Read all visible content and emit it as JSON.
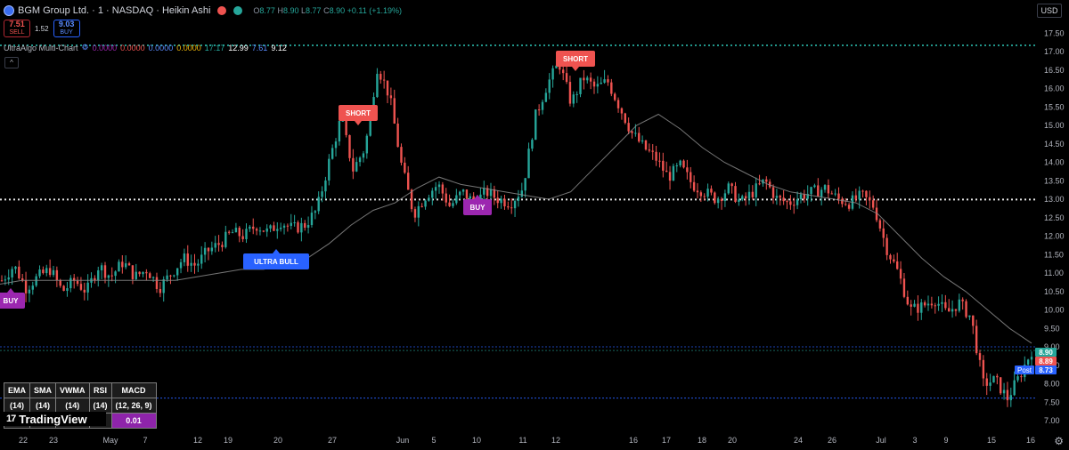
{
  "header": {
    "title": "BGM Group Ltd. · 1 · NASDAQ · Heikin Ashi",
    "ohlc": {
      "o_label": "O",
      "o": "8.77",
      "h_label": "H",
      "h": "8.90",
      "l_label": "L",
      "l": "8.77",
      "c_label": "C",
      "c": "8.90",
      "chg": "+0.11 (+1.19%)"
    },
    "sell_price": "7.51",
    "sell_label": "SELL",
    "spread": "1.52",
    "buy_price": "9.03",
    "buy_label": "BUY",
    "currency": "USD"
  },
  "indicator": {
    "name": "UltraAlgo Multi-Chart",
    "values": [
      "0.0000",
      "0.0000",
      "0.0000",
      "0.0000",
      "17.17",
      "12.99",
      "7.61",
      "9.12"
    ],
    "colors": [
      "#9c27b0",
      "#ef5350",
      "#5b8cff",
      "#f0b90b",
      "#26a69a",
      "#ffffff",
      "#5b8cff",
      "#ffffff"
    ]
  },
  "price_tags": {
    "close": "8.90",
    "bid": "8.89",
    "post_label": "Post",
    "post": "8.73"
  },
  "ma_table": {
    "headers": [
      "EMA",
      "SMA",
      "VWMA",
      "RSI",
      "MACD"
    ],
    "params": [
      "(14)",
      "(14)",
      "(14)",
      "(14)",
      "(12, 26, 9)"
    ],
    "values": [
      "",
      "",
      "",
      "1",
      "0.01"
    ]
  },
  "brand": "TradingView",
  "chart_data": {
    "type": "candlestick",
    "style": "Heikin Ashi",
    "symbol": "BGM Group Ltd.",
    "interval": "1",
    "exchange": "NASDAQ",
    "ylim": [
      6.8,
      17.5
    ],
    "yticks": [
      7.0,
      7.5,
      8.0,
      8.5,
      9.0,
      9.5,
      10.0,
      10.5,
      11.0,
      11.5,
      12.0,
      12.5,
      13.0,
      13.5,
      14.0,
      14.5,
      15.0,
      15.5,
      16.0,
      16.5,
      17.0,
      17.5
    ],
    "xticks": [
      "22",
      "23",
      "May",
      "7",
      "12",
      "19",
      "20",
      "27",
      "Jun",
      "5",
      "10",
      "11",
      "12",
      "16",
      "17",
      "18",
      "20",
      "24",
      "26",
      "Jul",
      "3",
      "9",
      "15",
      "16"
    ],
    "hlines": [
      {
        "value": 17.17,
        "color": "#26a69a",
        "style": "dotted"
      },
      {
        "value": 12.99,
        "color": "#ffffff",
        "style": "dotted"
      },
      {
        "value": 7.61,
        "color": "#2962ff",
        "style": "dotted"
      }
    ],
    "path": [
      10.8,
      11.2,
      10.6,
      10.9,
      11.1,
      10.5,
      10.8,
      10.5,
      11.2,
      10.9,
      11.3,
      10.9,
      11.1,
      10.6,
      11.0,
      11.4,
      11.2,
      11.6,
      11.8,
      12.1,
      12.0,
      12.3,
      12.1,
      12.4,
      12.2,
      12.3,
      12.7,
      14.0,
      15.2,
      13.8,
      14.4,
      16.6,
      15.8,
      13.9,
      12.6,
      13.1,
      13.4,
      12.8,
      13.2,
      12.9,
      13.2,
      13.0,
      12.9,
      13.3,
      15.2,
      16.1,
      16.7,
      15.6,
      16.3,
      16.0,
      16.2,
      15.5,
      14.8,
      14.4,
      14.1,
      13.6,
      13.9,
      13.4,
      13.2,
      13.0,
      13.3,
      12.9,
      13.2,
      13.5,
      13.0,
      12.9,
      13.1,
      13.2,
      13.3,
      13.0,
      12.9,
      13.1,
      12.8,
      11.7,
      11.0,
      10.0,
      10.1,
      10.3,
      9.9,
      10.2,
      9.8,
      8.0,
      8.1,
      7.6,
      8.2,
      8.9
    ],
    "ema_path": [
      10.7,
      10.8,
      10.8,
      10.8,
      10.8,
      10.8,
      10.8,
      10.8,
      10.8,
      10.9,
      11.0,
      11.1,
      11.1,
      11.2,
      11.4,
      11.8,
      12.3,
      12.7,
      12.9,
      13.3,
      13.6,
      13.4,
      13.3,
      13.2,
      13.1,
      13.0,
      13.2,
      13.8,
      14.4,
      15.0,
      15.3,
      14.9,
      14.4,
      14.0,
      13.7,
      13.4,
      13.2,
      13.1,
      13.0,
      12.9,
      12.6,
      12.0,
      11.4,
      10.9,
      10.5,
      10.0,
      9.5,
      9.1
    ],
    "signals": [
      {
        "label": "BUY",
        "color": "#9c27b0"
      },
      {
        "label": "ULTRA BULL",
        "color": "#2962ff"
      },
      {
        "label": "SHORT",
        "color": "#ef5350"
      },
      {
        "label": "BUY",
        "color": "#9c27b0"
      },
      {
        "label": "SHORT",
        "color": "#ef5350"
      }
    ]
  }
}
